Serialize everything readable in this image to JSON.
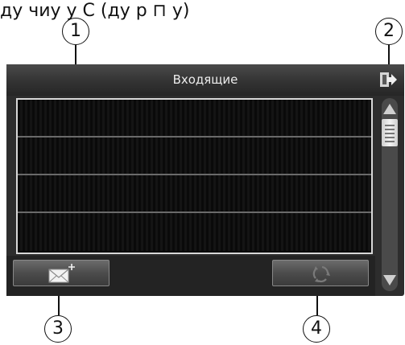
{
  "doc_header": {
    "text": "ду чиу у С (ду р ⊓ у)"
  },
  "callouts": [
    "1",
    "2",
    "3",
    "4"
  ],
  "titlebar": {
    "title": "Входящие"
  },
  "icons": {
    "exit": "exit-icon",
    "new_message": "envelope-plus-icon",
    "delete": "recycle-icon",
    "scroll_up": "arrow-up-icon",
    "scroll_down": "arrow-down-icon"
  },
  "message_list": {
    "rows": [
      "",
      "",
      "",
      ""
    ]
  },
  "colors": {
    "screen_bg": "#2d2d2d",
    "list_bg": "#050505",
    "row_divider": "#6a6a6a",
    "button": "#4c4c4c"
  }
}
